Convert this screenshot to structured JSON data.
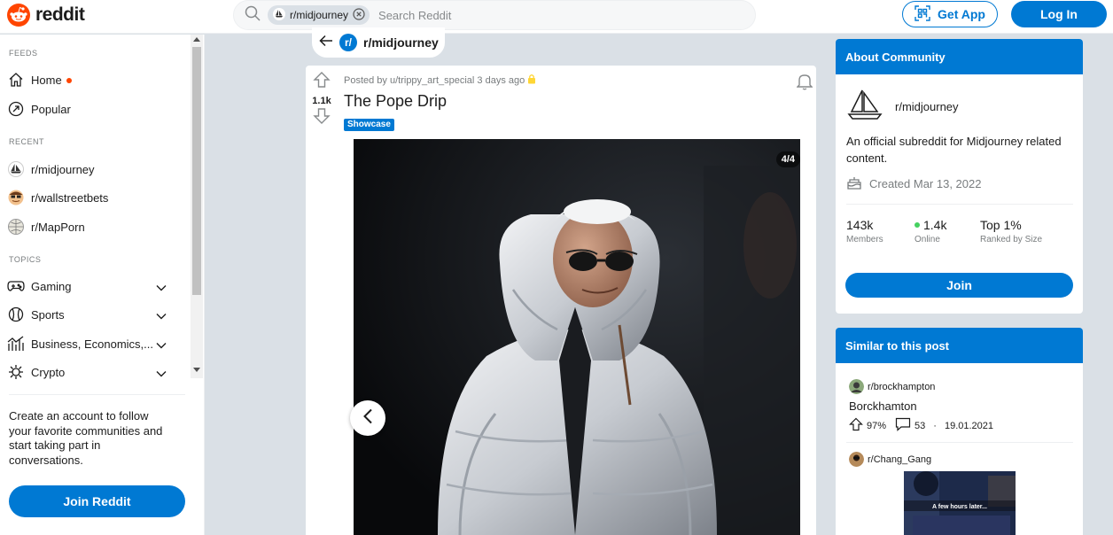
{
  "header": {
    "logo_text": "reddit",
    "search_chip": "r/midjourney",
    "search_placeholder": "Search Reddit",
    "get_app_label": "Get App",
    "login_label": "Log In"
  },
  "sidebar": {
    "feeds_heading": "FEEDS",
    "feeds": [
      {
        "label": "Home",
        "icon": "home-icon"
      },
      {
        "label": "Popular",
        "icon": "popular-icon"
      }
    ],
    "recent_heading": "RECENT",
    "recent": [
      {
        "label": "r/midjourney"
      },
      {
        "label": "r/wallstreetbets"
      },
      {
        "label": "r/MapPorn"
      }
    ],
    "topics_heading": "TOPICS",
    "topics": [
      {
        "label": "Gaming",
        "icon": "gamepad-icon"
      },
      {
        "label": "Sports",
        "icon": "baseball-icon"
      },
      {
        "label": "Business, Economics,...",
        "icon": "chart-icon"
      },
      {
        "label": "Crypto",
        "icon": "crypto-icon"
      }
    ],
    "cta_text": "Create an account to follow your favorite communities and start taking part in conversations.",
    "join_label": "Join Reddit"
  },
  "subreddit_pill": {
    "badge": "r/",
    "name": "r/midjourney"
  },
  "post": {
    "score": "1.1k",
    "meta": "Posted by u/trippy_art_special 3 days ago",
    "title": "The Pope Drip",
    "flair": "Showcase",
    "gallery_counter": "4/4"
  },
  "about": {
    "heading": "About Community",
    "name": "r/midjourney",
    "description": "An official subreddit for Midjourney related content.",
    "created": "Created Mar 13, 2022",
    "stats": [
      {
        "value": "143k",
        "label": "Members"
      },
      {
        "value": "1.4k",
        "label": "Online"
      },
      {
        "value": "Top 1%",
        "label": "Ranked by Size"
      }
    ],
    "join_label": "Join"
  },
  "similar": {
    "heading": "Similar to this post",
    "items": [
      {
        "subreddit": "r/brockhampton",
        "title": "Borckhamton",
        "upvote_pct": "97%",
        "comments": "53",
        "date": "19.01.2021"
      },
      {
        "subreddit": "r/Chang_Gang",
        "thumb_caption": "A few hours later..."
      }
    ]
  },
  "colors": {
    "brand_orange": "#ff4500",
    "brand_blue": "#0079d3",
    "online_green": "#46d160"
  }
}
